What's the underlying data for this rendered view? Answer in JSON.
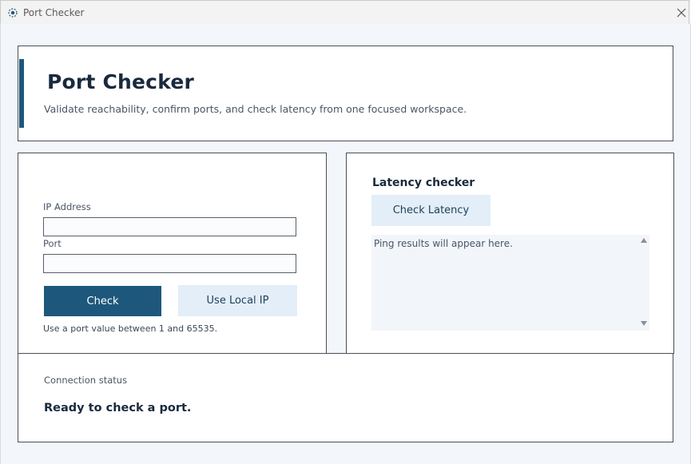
{
  "window": {
    "title": "Port Checker"
  },
  "header": {
    "title": "Port Checker",
    "subtitle": "Validate reachability, confirm ports, and check latency from one focused workspace."
  },
  "port_form": {
    "ip_label": "IP Address",
    "ip_value": "",
    "port_label": "Port",
    "port_value": "",
    "check_button": "Check",
    "local_ip_button": "Use Local IP",
    "hint": "Use a port value between 1 and 65535."
  },
  "latency": {
    "title": "Latency checker",
    "check_button": "Check Latency",
    "results_text": "Ping results will appear here."
  },
  "status": {
    "label": "Connection status",
    "value": "Ready to check a port."
  },
  "colors": {
    "accent": "#1d587c",
    "secondary_button": "#e3eef8",
    "background": "#f3f6fa"
  }
}
